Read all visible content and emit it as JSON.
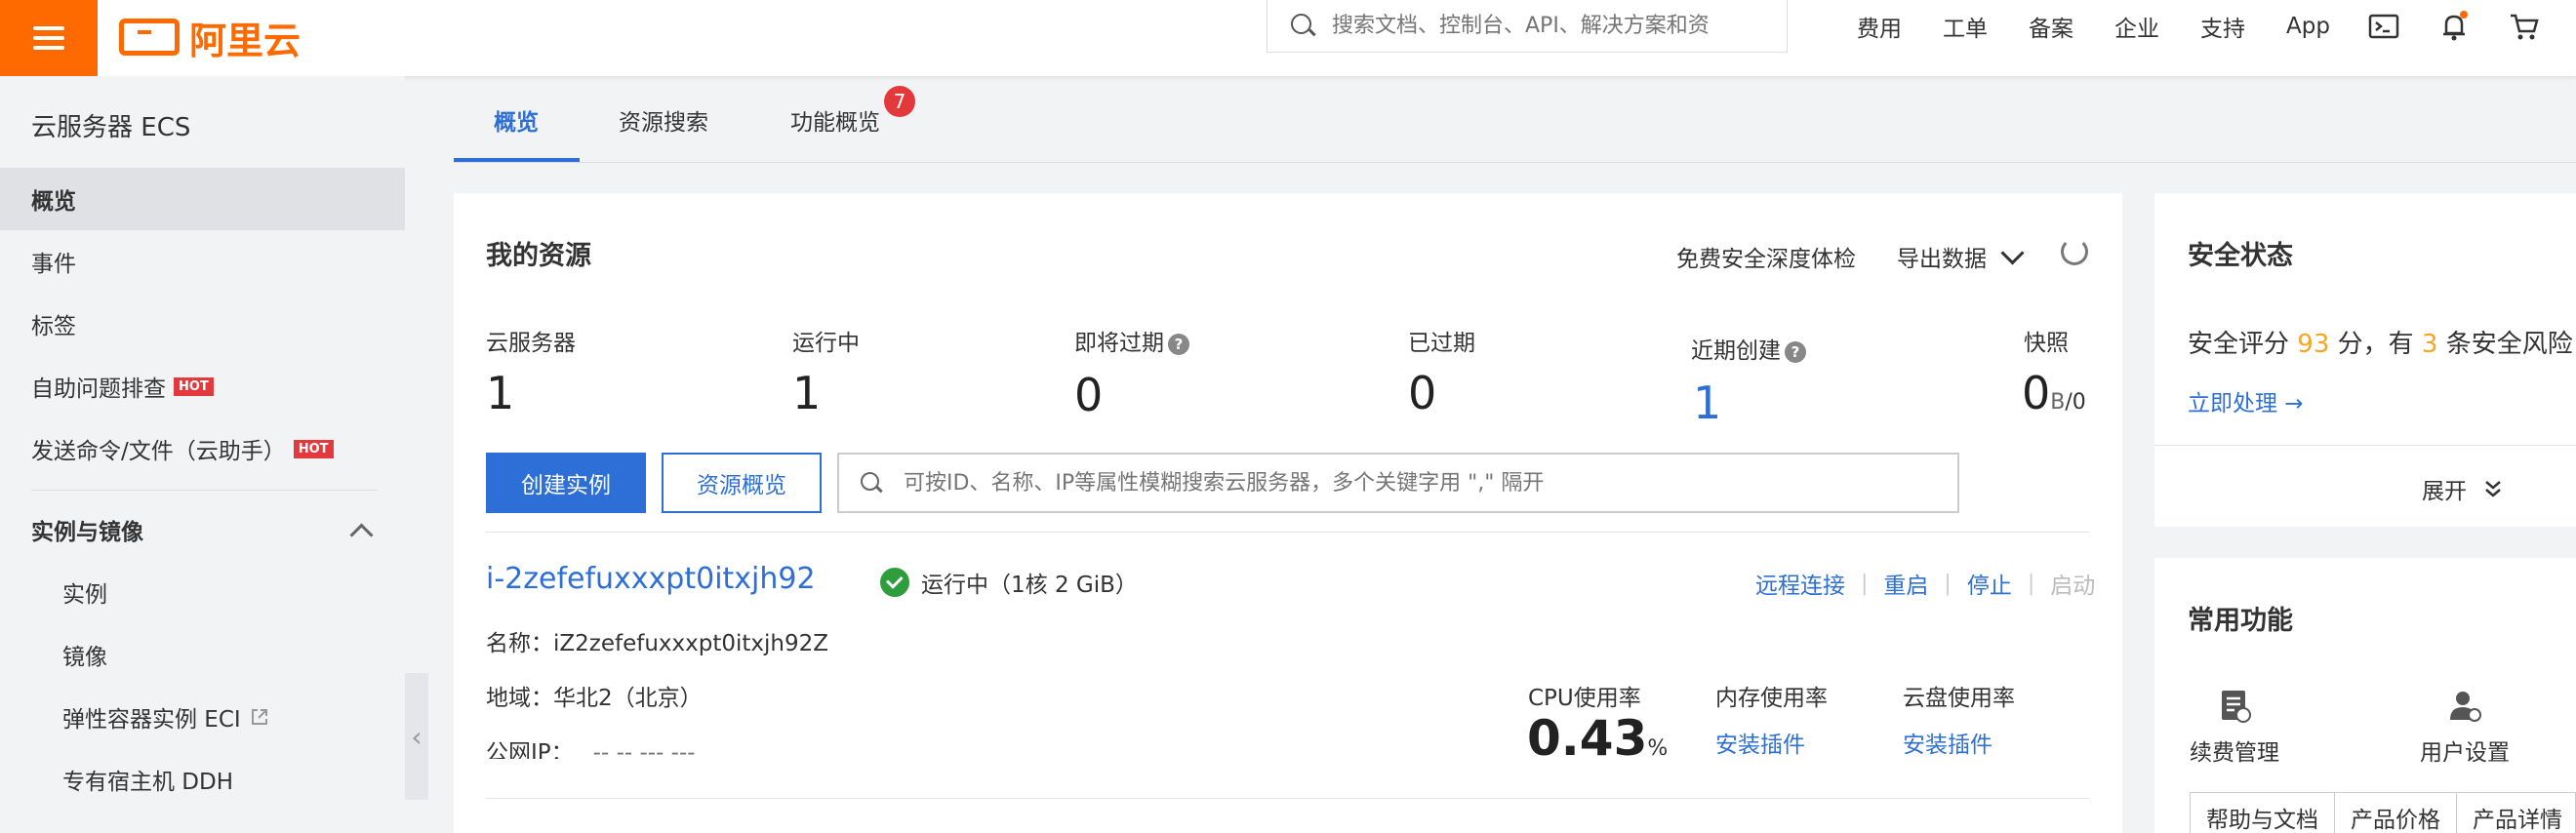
{
  "topbar": {
    "logo": "阿里云",
    "search_placeholder": "搜索文档、控制台、API、解决方案和资",
    "nav": [
      "费用",
      "工单",
      "备案",
      "企业",
      "支持",
      "App"
    ]
  },
  "sidebar": {
    "title": "云服务器 ECS",
    "items": [
      {
        "label": "概览"
      },
      {
        "label": "事件"
      },
      {
        "label": "标签"
      },
      {
        "label": "自助问题排查",
        "badge": "HOT"
      },
      {
        "label": "发送命令/文件（云助手）",
        "badge": "HOT"
      }
    ],
    "section": "实例与镜像",
    "sub_items": [
      "实例",
      "镜像",
      "弹性容器实例 ECI",
      "专有宿主机 DDH"
    ]
  },
  "tabs": [
    "概览",
    "资源搜索",
    "功能概览"
  ],
  "tab_badge": "7",
  "resources": {
    "title": "我的资源",
    "action_free": "免费安全深度体检",
    "action_export": "导出数据",
    "stats": [
      {
        "label": "云服务器",
        "value": "1"
      },
      {
        "label": "运行中",
        "value": "1"
      },
      {
        "label": "即将过期",
        "value": "0"
      },
      {
        "label": "已过期",
        "value": "0"
      },
      {
        "label": "近期创建",
        "value": "1"
      },
      {
        "label": "快照",
        "value": "0",
        "unit": "B",
        "tail": "/0"
      }
    ],
    "btn_create": "创建实例",
    "btn_overview": "资源概览",
    "filter_placeholder": "可按ID、名称、IP等属性模糊搜索云服务器，多个关键字用 \",\" 隔开",
    "instance": {
      "id": "i-2zefefuxxxpt0itxjh92",
      "status": "运行中",
      "spec": "（1核 2 GiB）",
      "actions": [
        "远程连接",
        "重启",
        "停止",
        "启动"
      ],
      "name_label": "名称：",
      "name_value": "iZ2zefefuxxxpt0itxjh92Z",
      "region_label": "地域：",
      "region_value": "华北2（北京）",
      "ip_label": "公网IP：",
      "ip_value": "-- -- --- ---",
      "cpu_label": "CPU使用率",
      "cpu_value": "0.43",
      "cpu_unit": "%",
      "mem_label": "内存使用率",
      "mem_link": "安装插件",
      "disk_label": "云盘使用率",
      "disk_link": "安装插件"
    }
  },
  "security": {
    "title": "安全状态",
    "text_a": "安全评分",
    "score": "93",
    "text_b": "分，有",
    "count": "3",
    "text_c": "条安全风险",
    "action": "立即处理 →",
    "expand": "展开"
  },
  "common": {
    "title": "常用功能",
    "items": [
      "续费管理",
      "用户设置"
    ],
    "tabs": [
      "帮助与文档",
      "产品价格",
      "产品详情"
    ]
  },
  "colors": {
    "accent": "#2d6fd6",
    "brand": "#ff6a00",
    "hot": "#e4393c",
    "score": "#f5a623",
    "success": "#2e9d3c"
  }
}
